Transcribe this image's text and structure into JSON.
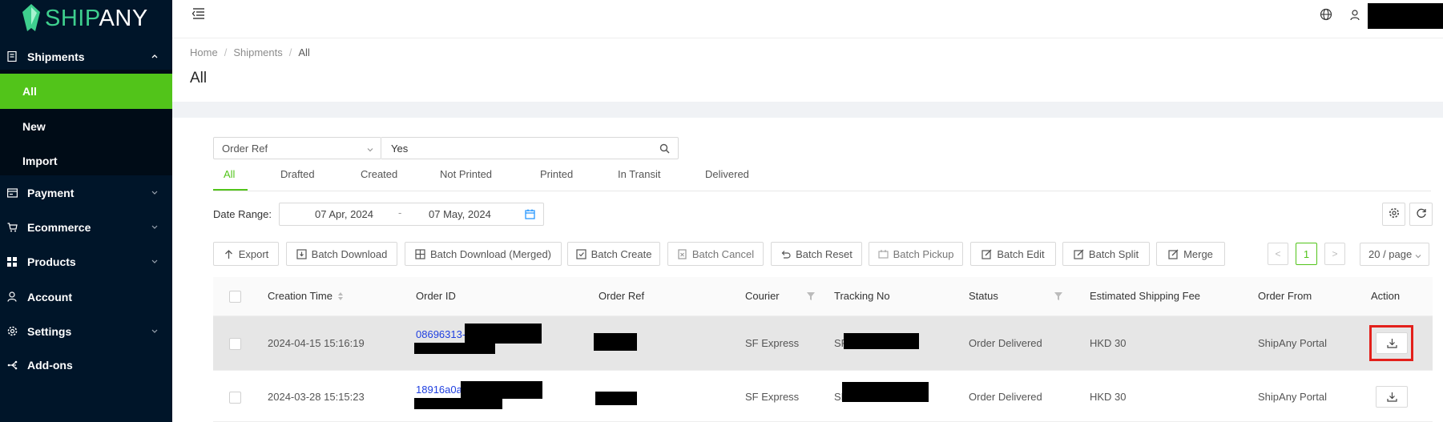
{
  "brand": {
    "logo_ship": "SHIP",
    "logo_any": "ANY",
    "accent": "#52c41a",
    "sidebar_bg": "#001529"
  },
  "sidebar": {
    "items": [
      {
        "label": "Shipments",
        "icon": "shipments-icon",
        "expanded": true
      },
      {
        "label": "Payment",
        "icon": "payment-icon"
      },
      {
        "label": "Ecommerce",
        "icon": "cart-icon"
      },
      {
        "label": "Products",
        "icon": "grid-icon"
      },
      {
        "label": "Account",
        "icon": "user-icon"
      },
      {
        "label": "Settings",
        "icon": "gear-icon"
      },
      {
        "label": "Add-ons",
        "icon": "addons-icon"
      }
    ],
    "sub_items": [
      {
        "label": "All",
        "active": true
      },
      {
        "label": "New"
      },
      {
        "label": "Import"
      }
    ]
  },
  "breadcrumb": [
    "Home",
    "Shipments",
    "All"
  ],
  "page_title": "All",
  "search": {
    "field": "Order Ref",
    "value": "Yes"
  },
  "tabs": [
    "All",
    "Drafted",
    "Created",
    "Not Printed",
    "Printed",
    "In Transit",
    "Delivered"
  ],
  "date_range": {
    "label": "Date Range:",
    "from": "07 Apr, 2024",
    "sep": "-",
    "to": "07 May, 2024"
  },
  "toolbar": [
    "Export",
    "Batch Download",
    "Batch Download (Merged)",
    "Batch Create",
    "Batch Cancel",
    "Batch Reset",
    "Batch Pickup",
    "Batch Edit",
    "Batch Split",
    "Merge"
  ],
  "pagination": {
    "prev": "<",
    "current": "1",
    "next": ">",
    "page_size": "20 / page"
  },
  "table": {
    "columns": [
      "Creation Time",
      "Order ID",
      "Order Ref",
      "Courier",
      "Tracking No",
      "Status",
      "Estimated Shipping Fee",
      "Order From",
      "Action"
    ],
    "rows": [
      {
        "creation_time": "2024-04-15 15:16:19",
        "order_id": "08696313-",
        "courier": "SF Express",
        "tracking_prefix": "SF",
        "status": "Order Delivered",
        "fee": "HKD 30",
        "order_from": "ShipAny Portal"
      },
      {
        "creation_time": "2024-03-28 15:15:23",
        "order_id": "18916a0a-",
        "courier": "SF Express",
        "tracking_prefix": "SF",
        "status": "Order Delivered",
        "fee": "HKD 30",
        "order_from": "ShipAny Portal"
      }
    ]
  }
}
